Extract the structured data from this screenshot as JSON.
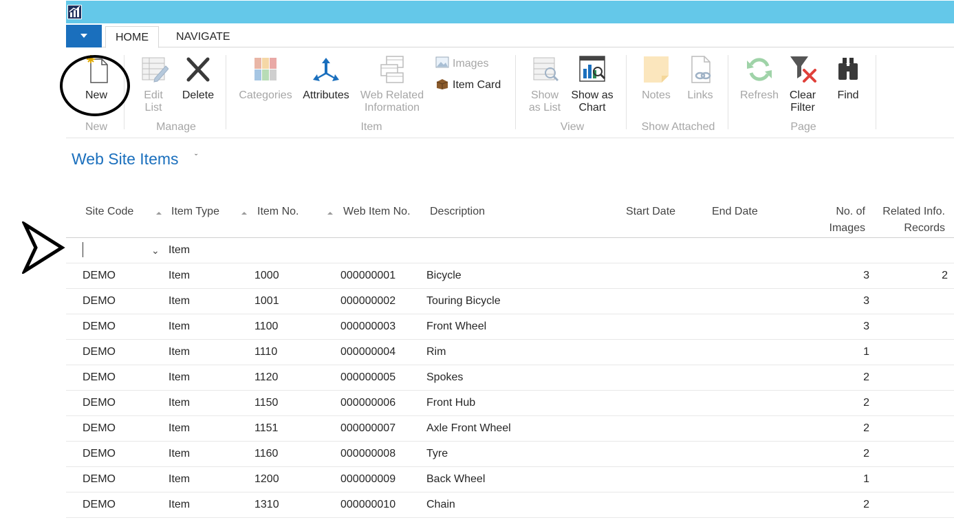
{
  "titlebar": {
    "color": "#64c8e9"
  },
  "tabs": [
    {
      "label": "HOME",
      "active": true
    },
    {
      "label": "NAVIGATE",
      "active": false
    }
  ],
  "ribbon": {
    "new_group": {
      "label": "New",
      "new": "New"
    },
    "manage_group": {
      "label": "Manage",
      "edit_list": "Edit List",
      "edit_line1": "Edit",
      "edit_line2": "List",
      "delete": "Delete"
    },
    "item_group": {
      "label": "Item",
      "categories": "Categories",
      "attributes": "Attributes",
      "web_related_line1": "Web Related",
      "web_related_line2": "Information",
      "images": "Images",
      "item_card": "Item Card"
    },
    "view_group": {
      "label": "View",
      "show_list_line1": "Show",
      "show_list_line2": "as List",
      "show_chart_line1": "Show as",
      "show_chart_line2": "Chart"
    },
    "show_attached_group": {
      "label": "Show Attached",
      "notes": "Notes",
      "links": "Links"
    },
    "page_group": {
      "label": "Page",
      "refresh": "Refresh",
      "clear_filter_line1": "Clear",
      "clear_filter_line2": "Filter",
      "find": "Find"
    }
  },
  "page": {
    "title": "Web Site Items",
    "title_dropdown": "ˇ"
  },
  "grid": {
    "headers": {
      "site_code": "Site Code",
      "item_type": "Item Type",
      "item_no": "Item No.",
      "web_item_no": "Web Item No.",
      "description": "Description",
      "start_date": "Start Date",
      "end_date": "End Date",
      "no_images_line1": "No. of",
      "no_images_line2": "Images",
      "related_line1": "Related Info.",
      "related_line2": "Records"
    },
    "new_row": {
      "item_type": "Item"
    },
    "rows": [
      {
        "site_code": "DEMO",
        "item_type": "Item",
        "item_no": "1000",
        "web_item_no": "000000001",
        "description": "Bicycle",
        "images": "3",
        "related": "2"
      },
      {
        "site_code": "DEMO",
        "item_type": "Item",
        "item_no": "1001",
        "web_item_no": "000000002",
        "description": "Touring Bicycle",
        "images": "3",
        "related": ""
      },
      {
        "site_code": "DEMO",
        "item_type": "Item",
        "item_no": "1100",
        "web_item_no": "000000003",
        "description": "Front Wheel",
        "images": "3",
        "related": ""
      },
      {
        "site_code": "DEMO",
        "item_type": "Item",
        "item_no": "1110",
        "web_item_no": "000000004",
        "description": "Rim",
        "images": "1",
        "related": ""
      },
      {
        "site_code": "DEMO",
        "item_type": "Item",
        "item_no": "1120",
        "web_item_no": "000000005",
        "description": "Spokes",
        "images": "2",
        "related": ""
      },
      {
        "site_code": "DEMO",
        "item_type": "Item",
        "item_no": "1150",
        "web_item_no": "000000006",
        "description": "Front Hub",
        "images": "2",
        "related": ""
      },
      {
        "site_code": "DEMO",
        "item_type": "Item",
        "item_no": "1151",
        "web_item_no": "000000007",
        "description": "Axle Front Wheel",
        "images": "2",
        "related": ""
      },
      {
        "site_code": "DEMO",
        "item_type": "Item",
        "item_no": "1160",
        "web_item_no": "000000008",
        "description": "Tyre",
        "images": "2",
        "related": ""
      },
      {
        "site_code": "DEMO",
        "item_type": "Item",
        "item_no": "1200",
        "web_item_no": "000000009",
        "description": "Back Wheel",
        "images": "1",
        "related": ""
      },
      {
        "site_code": "DEMO",
        "item_type": "Item",
        "item_no": "1310",
        "web_item_no": "000000010",
        "description": "Chain",
        "images": "2",
        "related": ""
      }
    ]
  },
  "icons": {
    "app": "app-logo-icon",
    "new": "new-document-icon",
    "edit_list": "edit-list-icon",
    "delete": "delete-x-icon",
    "categories": "categories-icon",
    "attributes": "attributes-icon",
    "web_related": "web-related-icon",
    "images": "images-icon",
    "item_card": "item-card-icon",
    "show_list": "show-list-icon",
    "show_chart": "show-chart-icon",
    "notes": "notes-icon",
    "links": "links-icon",
    "refresh": "refresh-icon",
    "clear_filter": "clear-filter-icon",
    "find": "binoculars-icon"
  },
  "colors": {
    "accent": "#1a6fbd",
    "titlebar": "#64c8e9",
    "disabled": "#a6a6a6"
  }
}
